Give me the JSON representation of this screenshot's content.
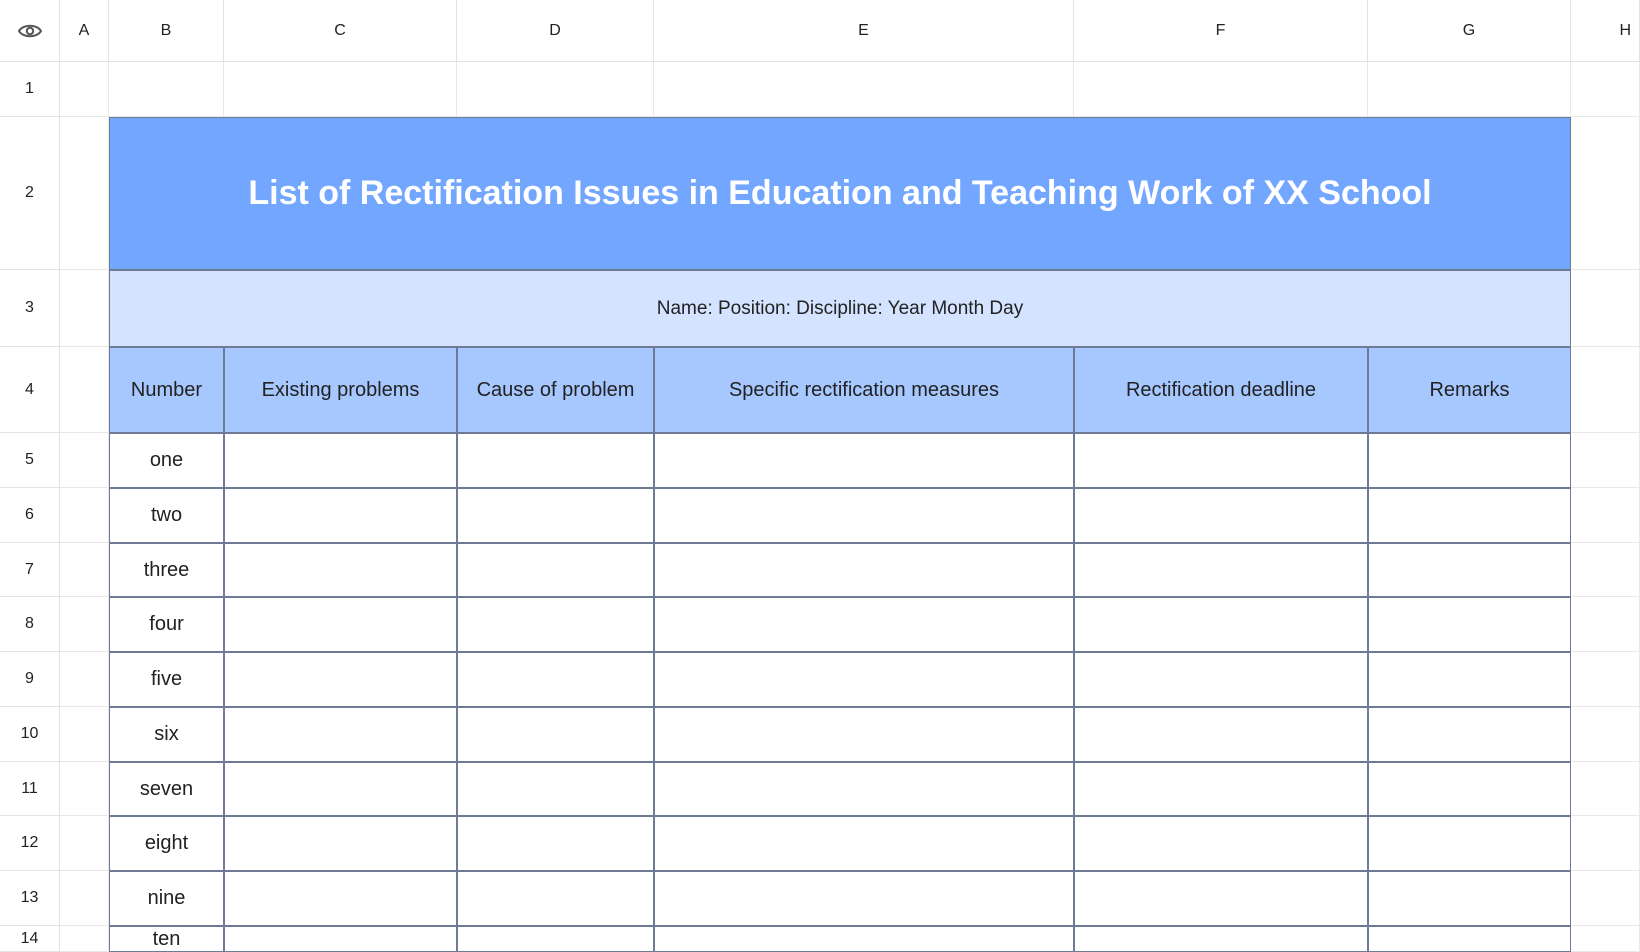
{
  "column_headers": [
    "A",
    "B",
    "C",
    "D",
    "E",
    "F",
    "G",
    "H"
  ],
  "row_headers": [
    "1",
    "2",
    "3",
    "4",
    "5",
    "6",
    "7",
    "8",
    "9",
    "10",
    "11",
    "12",
    "13",
    "14"
  ],
  "corner_icon": "eye-icon",
  "sheet": {
    "title": "List of Rectification Issues in Education and Teaching Work of XX School",
    "subtitle": "Name: Position: Discipline: Year Month Day",
    "table_headers": [
      "Number",
      "Existing problems",
      "Cause of problem",
      "Specific rectification measures",
      "Rectification deadline",
      "Remarks"
    ],
    "numbers": [
      "one",
      "two",
      "three",
      "four",
      "five",
      "six",
      "seven",
      "eight",
      "nine",
      "ten"
    ]
  },
  "colors": {
    "title_bg": "#73a7ff",
    "subtitle_bg": "#d4e3ff",
    "header_bg": "#a7c7ff",
    "border": "#6f7b96"
  }
}
